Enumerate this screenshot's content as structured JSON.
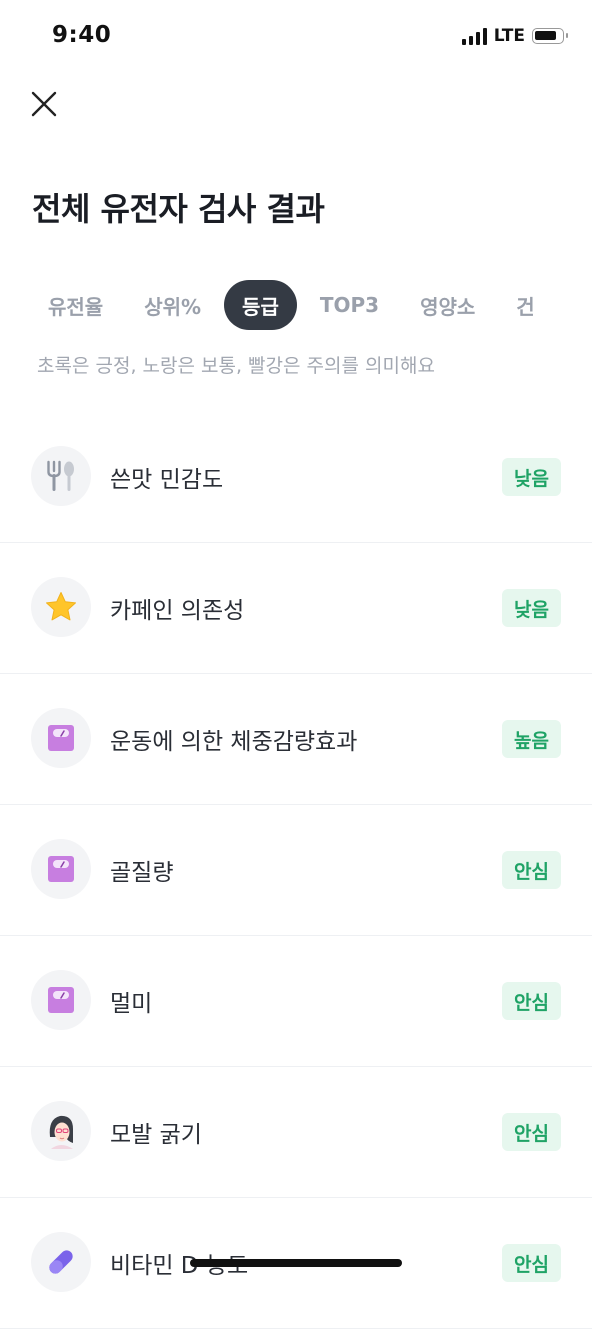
{
  "status_bar": {
    "time": "9:40",
    "network": "LTE"
  },
  "header": {
    "title": "전체 유전자 검사 결과"
  },
  "tabs": [
    {
      "label": "유전율",
      "active": false
    },
    {
      "label": "상위%",
      "active": false
    },
    {
      "label": "등급",
      "active": true
    },
    {
      "label": "TOP3",
      "active": false
    },
    {
      "label": "영양소",
      "active": false
    },
    {
      "label": "건",
      "active": false
    }
  ],
  "legend_text": "초록은 긍정, 노랑은 보통, 빨강은 주의를 의미해요",
  "results": [
    {
      "label": "쓴맛 민감도",
      "grade": "낮음",
      "icon": "utensils-icon"
    },
    {
      "label": "카페인 의존성",
      "grade": "낮음",
      "icon": "star-icon"
    },
    {
      "label": "운동에 의한 체중감량효과",
      "grade": "높음",
      "icon": "scale-icon"
    },
    {
      "label": "골질량",
      "grade": "안심",
      "icon": "scale-icon"
    },
    {
      "label": "멀미",
      "grade": "안심",
      "icon": "scale-icon"
    },
    {
      "label": "모발 굵기",
      "grade": "안심",
      "icon": "woman-face-icon"
    },
    {
      "label": "비타민 D 농도",
      "grade": "안심",
      "icon": "pill-icon"
    }
  ],
  "colors": {
    "badge_bg": "#e6f7ee",
    "badge_text": "#1fa366",
    "active_tab": "#343a44",
    "scale": "#c77ee0"
  }
}
